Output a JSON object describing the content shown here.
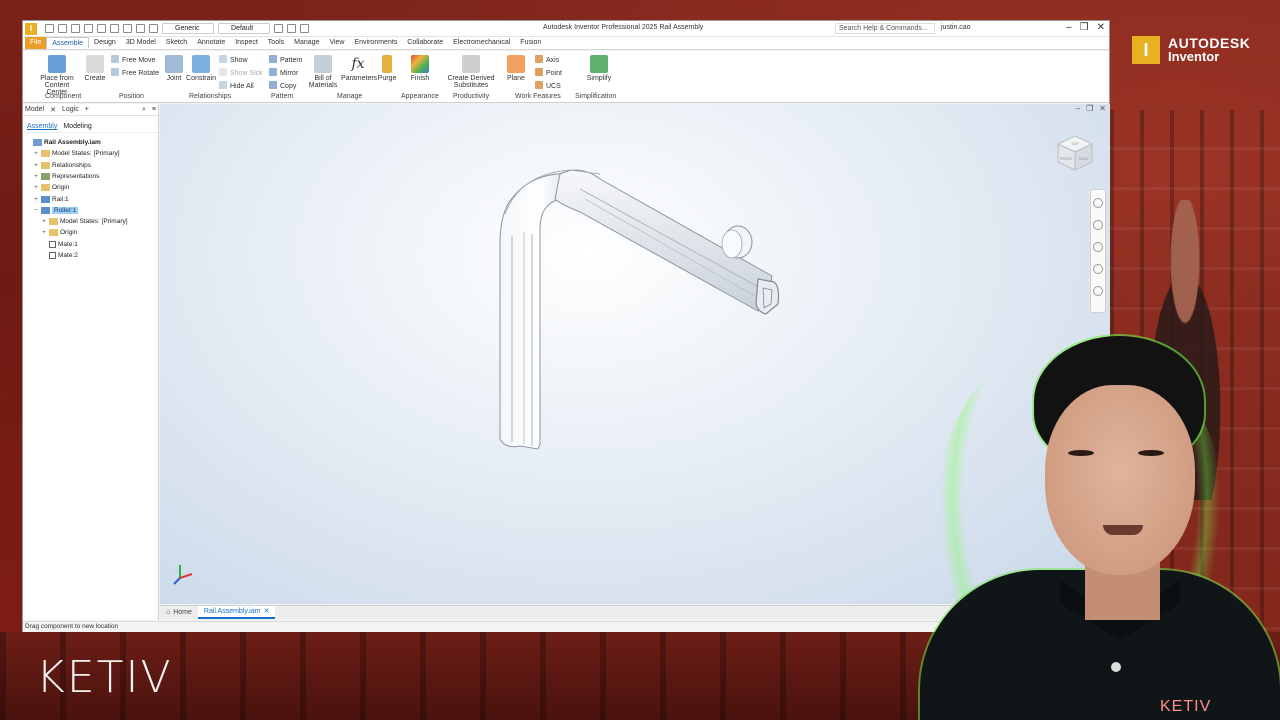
{
  "window": {
    "title": "Autodesk Inventor Professional 2025   Rail Assembly",
    "search_placeholder": "Search Help & Commands...",
    "user": "justin.cao",
    "material_combo": "Generic",
    "appearance_combo": "Default"
  },
  "tabs": [
    "File",
    "Assemble",
    "Design",
    "3D Model",
    "Sketch",
    "Annotate",
    "Inspect",
    "Tools",
    "Manage",
    "View",
    "Environments",
    "Collaborate",
    "Electromechanical",
    "Fusion"
  ],
  "ribbon": {
    "place_from_content_center": "Place from Content Center",
    "create": "Create",
    "free_move": "Free Move",
    "free_rotate": "Free Rotate",
    "joint": "Joint",
    "constrain": "Constrain",
    "show": "Show",
    "show_sick": "Show Sick",
    "hide_all": "Hide All",
    "pattern": "Pattern",
    "mirror": "Mirror",
    "copy": "Copy",
    "bill_of_materials": "Bill of Materials",
    "parameters": "Parameters",
    "purge": "Purge",
    "finish": "Finish",
    "create_derived_substitutes": "Create Derived Substitutes",
    "plane": "Plane",
    "axis": "Axis",
    "point": "Point",
    "ucs": "UCS",
    "simplify": "Simplify",
    "panels": {
      "component": "Component",
      "position": "Position",
      "relationships": "Relationships",
      "pattern": "Pattern",
      "manage": "Manage",
      "appearance": "Appearance",
      "productivity": "Productivity",
      "work_features": "Work Features",
      "simplification": "Simplification"
    }
  },
  "browser": {
    "tab_model": "Model",
    "tab_logic": "Logic",
    "sub_assembly": "Assembly",
    "sub_modeling": "Modeling",
    "nodes": [
      {
        "label": "Rail Assembly.iam",
        "kind": "asm",
        "indent": 0,
        "exp": ""
      },
      {
        "label": "Model States: [Primary]",
        "kind": "folder",
        "indent": 1,
        "exp": "+"
      },
      {
        "label": "Relationships",
        "kind": "folder",
        "indent": 1,
        "exp": "+"
      },
      {
        "label": "Representations",
        "kind": "rep",
        "indent": 1,
        "exp": "+"
      },
      {
        "label": "Origin",
        "kind": "folder",
        "indent": 1,
        "exp": "+"
      },
      {
        "label": "Rail:1",
        "kind": "part",
        "indent": 1,
        "exp": "+"
      },
      {
        "label": "Roller:1",
        "kind": "part",
        "indent": 1,
        "exp": "−",
        "selected": true
      },
      {
        "label": "Model States: [Primary]",
        "kind": "folder",
        "indent": 2,
        "exp": "+"
      },
      {
        "label": "Origin",
        "kind": "folder",
        "indent": 2,
        "exp": "+"
      },
      {
        "label": "Mate:1",
        "kind": "mate",
        "indent": 2,
        "exp": ""
      },
      {
        "label": "Mate:2",
        "kind": "mate",
        "indent": 2,
        "exp": ""
      }
    ]
  },
  "viewcube": {
    "top": "TOP",
    "front": "FRONT",
    "back": "BACK"
  },
  "doc_tabs": {
    "home": "Home",
    "active": "Rail Assembly.iam"
  },
  "status": "Drag component to new location",
  "overlay": {
    "brand_line1": "AUTODESK",
    "brand_line2": "Inventor",
    "ketiv_logo": "KETIV",
    "shirt_logo": "KETIV"
  },
  "colors": {
    "accent_file_tab": "#ec9d2a",
    "brand_yellow": "#e9b022",
    "selection": "#9ccff2"
  }
}
